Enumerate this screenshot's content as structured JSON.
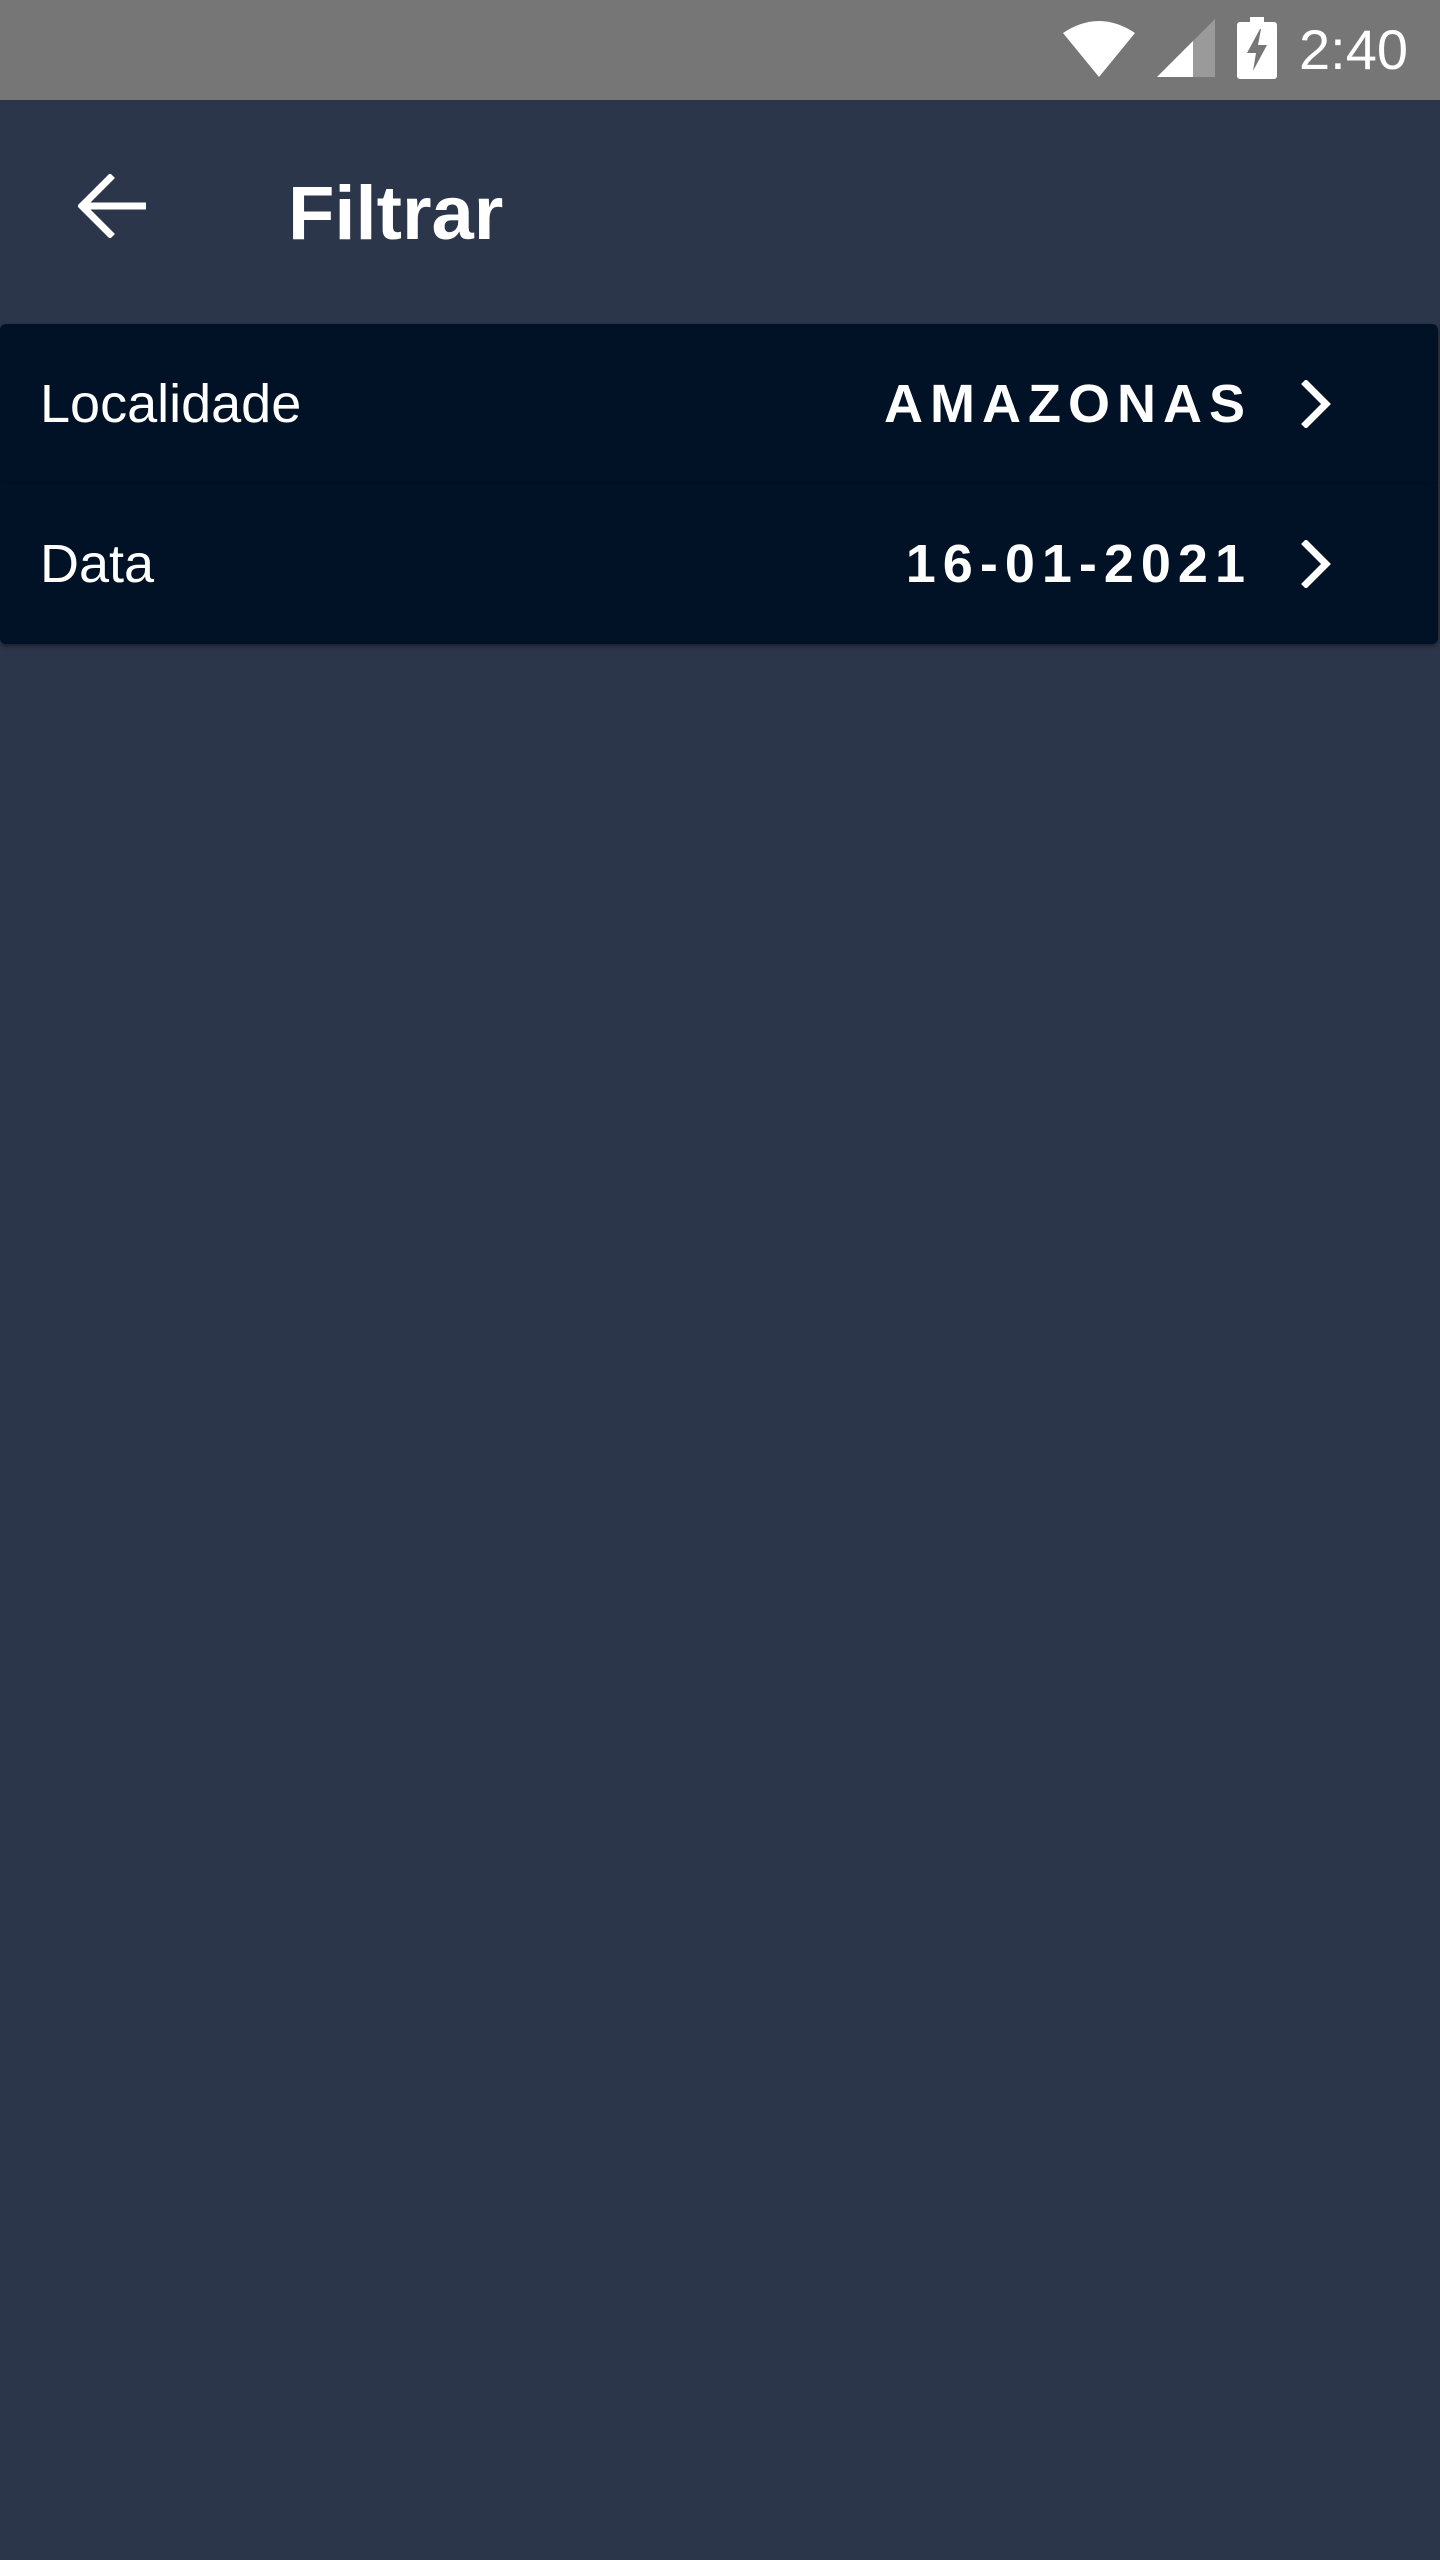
{
  "status_bar": {
    "time": "2:40",
    "icons": [
      "wifi-icon",
      "cell-signal-icon",
      "battery-charging-icon"
    ]
  },
  "app_bar": {
    "title": "Filtrar",
    "back_icon": "arrow-back-icon"
  },
  "filters": [
    {
      "label": "Localidade",
      "value": "AMAZONAS",
      "icon": "chevron-right-icon"
    },
    {
      "label": "Data",
      "value": "16-01-2021",
      "icon": "chevron-right-icon"
    }
  ],
  "colors": {
    "background": "#2c364a",
    "status_bar": "#767676",
    "row_background": "#011226",
    "text": "#ffffff"
  }
}
